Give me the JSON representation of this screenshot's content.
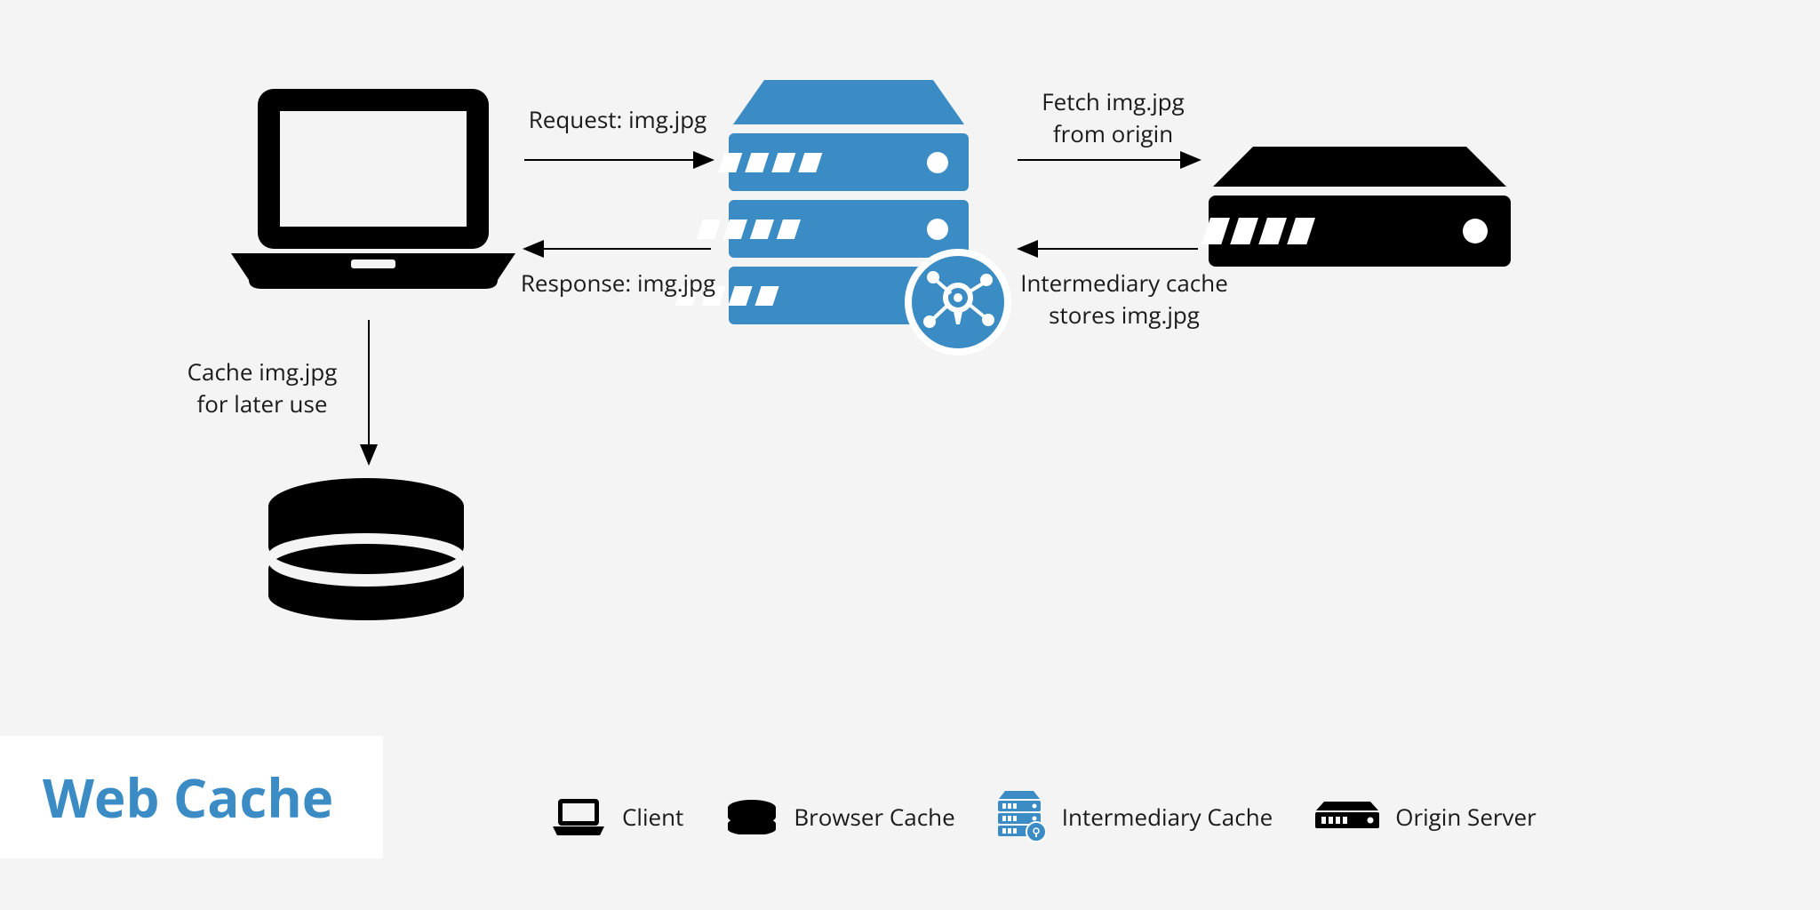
{
  "title": "Web Cache",
  "labels": {
    "request": "Request: img.jpg",
    "response": "Response: img.jpg",
    "fetch_line1": "Fetch img.jpg",
    "fetch_line2": "from origin",
    "store_line1": "Intermediary cache",
    "store_line2": "stores img.jpg",
    "local_cache_line1": "Cache img.jpg",
    "local_cache_line2": "for later use"
  },
  "legend": {
    "client": "Client",
    "browser_cache": "Browser Cache",
    "intermediary_cache": "Intermediary Cache",
    "origin_server": "Origin Server"
  },
  "colors": {
    "accent_blue": "#3b8bc4",
    "black": "#000000"
  }
}
